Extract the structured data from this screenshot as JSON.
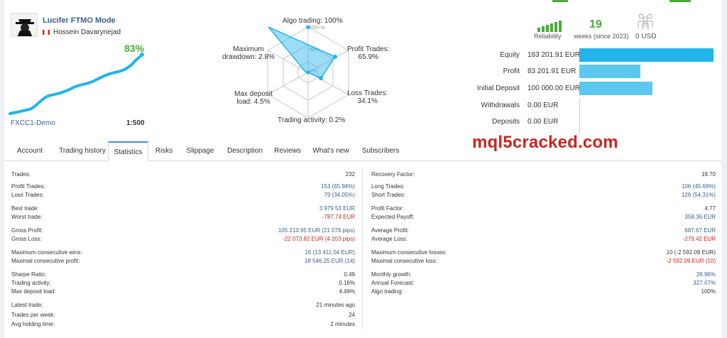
{
  "profile": {
    "title": "Lucifer FTMO Mode",
    "author": "Hossein Davarynejad",
    "growth": "83%",
    "broker": "FXCC1-Demo",
    "leverage": "1:500"
  },
  "radar": {
    "algo_trading": "Algo trading: 100%",
    "profit_trades": "Profit Trades:\n65.9%",
    "loss_trades": "Loss Trades:\n34.1%",
    "trading_activity": "Trading activity: 0.2%",
    "max_deposit_load": "Max deposit\nload: 4.5%",
    "max_drawdown": "Maximum\ndrawdown: 2.8%",
    "ring_labels": [
      "100+%",
      "50%",
      "0%"
    ]
  },
  "indicators": {
    "reliability_label": "Reliability",
    "weeks_value": "19",
    "weeks_label": "weeks (since 2023)",
    "subscribers_value": "0 USD"
  },
  "balance": [
    {
      "label": "Equity",
      "value": "183 201.91 EUR",
      "ratio": 1.0
    },
    {
      "label": "Profit",
      "value": "83 201.91 EUR",
      "ratio": 0.454
    },
    {
      "label": "Initial Deposit",
      "value": "100 000.00 EUR",
      "ratio": 0.546
    },
    {
      "label": "Withdrawals",
      "value": "0.00 EUR",
      "ratio": 0
    },
    {
      "label": "Deposits",
      "value": "0.00 EUR",
      "ratio": 0
    }
  ],
  "tabs": [
    "Account",
    "Trading history",
    "Statistics",
    "Risks",
    "Slippage",
    "Description",
    "Reviews",
    "What's new",
    "Subscribers"
  ],
  "watermark": "mql5cracked.com",
  "stats_left": [
    {
      "label": "Trades:",
      "value": "232"
    },
    {
      "label": "Profit Trades:",
      "value": "153 (65.94%)"
    },
    {
      "label": "Loss Trades:",
      "value": "79 (34.05%)"
    },
    {
      "label": "Best trade:",
      "value": "3 979.53 EUR"
    },
    {
      "label": "Worst trade:",
      "value": "-787.74 EUR"
    },
    {
      "label": "Gross Profit:",
      "value": "105 213.95 EUR (21 076 pips)"
    },
    {
      "label": "Gross Loss:",
      "value": "-22 073.82 EUR (4 203 pips)"
    },
    {
      "label": "Maximum consecutive wins:",
      "value": "16 (13 411.04 EUR)"
    },
    {
      "label": "Maximal consecutive profit:",
      "value": "18 546.25 EUR (14)"
    },
    {
      "label": "Sharpe Ratio:",
      "value": "0.49"
    },
    {
      "label": "Trading activity:",
      "value": "0.16%"
    },
    {
      "label": "Max deposit load:",
      "value": "4.49%"
    },
    {
      "label": "Latest trade:",
      "value": "21 minutes ago"
    },
    {
      "label": "Trades per week:",
      "value": "24"
    },
    {
      "label": "Avg holding time:",
      "value": "2 minutes"
    }
  ],
  "stats_right": [
    {
      "label": "Recovery Factor:",
      "value": "19.70"
    },
    {
      "label": "Long Trades:",
      "value": "106 (45.69%)"
    },
    {
      "label": "Short Trades:",
      "value": "126 (54.31%)"
    },
    {
      "label": "Profit Factor:",
      "value": "4.77"
    },
    {
      "label": "Expected Payoff:",
      "value": "358.36 EUR"
    },
    {
      "label": "Average Profit:",
      "value": "687.67 EUR"
    },
    {
      "label": "Average Loss:",
      "value": "-279.42 EUR"
    },
    {
      "label": "Maximum consecutive losses:",
      "value": "10 (-2 592.09 EUR)"
    },
    {
      "label": "Maximal consecutive loss:",
      "value": "-2 592.09 EUR (10)"
    },
    {
      "label": "Monthly growth:",
      "value": "26.96%"
    },
    {
      "label": "Annual Forecast:",
      "value": "327.07%"
    },
    {
      "label": "Algo trading:",
      "value": "100%"
    }
  ],
  "colors": {
    "accent_blue": "#22b4ea",
    "green": "#4caa3c",
    "red": "#c8261e",
    "link": "#3a5f8a"
  }
}
